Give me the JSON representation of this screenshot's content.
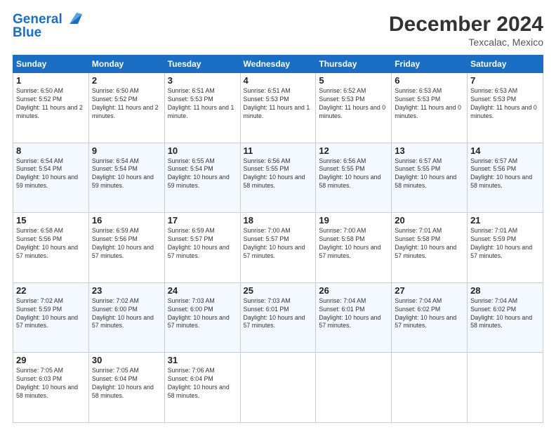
{
  "header": {
    "logo_line1": "General",
    "logo_line2": "Blue",
    "month": "December 2024",
    "location": "Texcalac, Mexico"
  },
  "weekdays": [
    "Sunday",
    "Monday",
    "Tuesday",
    "Wednesday",
    "Thursday",
    "Friday",
    "Saturday"
  ],
  "weeks": [
    [
      {
        "day": "1",
        "sunrise": "Sunrise: 6:50 AM",
        "sunset": "Sunset: 5:52 PM",
        "daylight": "Daylight: 11 hours and 2 minutes."
      },
      {
        "day": "2",
        "sunrise": "Sunrise: 6:50 AM",
        "sunset": "Sunset: 5:52 PM",
        "daylight": "Daylight: 11 hours and 2 minutes."
      },
      {
        "day": "3",
        "sunrise": "Sunrise: 6:51 AM",
        "sunset": "Sunset: 5:53 PM",
        "daylight": "Daylight: 11 hours and 1 minute."
      },
      {
        "day": "4",
        "sunrise": "Sunrise: 6:51 AM",
        "sunset": "Sunset: 5:53 PM",
        "daylight": "Daylight: 11 hours and 1 minute."
      },
      {
        "day": "5",
        "sunrise": "Sunrise: 6:52 AM",
        "sunset": "Sunset: 5:53 PM",
        "daylight": "Daylight: 11 hours and 0 minutes."
      },
      {
        "day": "6",
        "sunrise": "Sunrise: 6:53 AM",
        "sunset": "Sunset: 5:53 PM",
        "daylight": "Daylight: 11 hours and 0 minutes."
      },
      {
        "day": "7",
        "sunrise": "Sunrise: 6:53 AM",
        "sunset": "Sunset: 5:53 PM",
        "daylight": "Daylight: 11 hours and 0 minutes."
      }
    ],
    [
      {
        "day": "8",
        "sunrise": "Sunrise: 6:54 AM",
        "sunset": "Sunset: 5:54 PM",
        "daylight": "Daylight: 10 hours and 59 minutes."
      },
      {
        "day": "9",
        "sunrise": "Sunrise: 6:54 AM",
        "sunset": "Sunset: 5:54 PM",
        "daylight": "Daylight: 10 hours and 59 minutes."
      },
      {
        "day": "10",
        "sunrise": "Sunrise: 6:55 AM",
        "sunset": "Sunset: 5:54 PM",
        "daylight": "Daylight: 10 hours and 59 minutes."
      },
      {
        "day": "11",
        "sunrise": "Sunrise: 6:56 AM",
        "sunset": "Sunset: 5:55 PM",
        "daylight": "Daylight: 10 hours and 58 minutes."
      },
      {
        "day": "12",
        "sunrise": "Sunrise: 6:56 AM",
        "sunset": "Sunset: 5:55 PM",
        "daylight": "Daylight: 10 hours and 58 minutes."
      },
      {
        "day": "13",
        "sunrise": "Sunrise: 6:57 AM",
        "sunset": "Sunset: 5:55 PM",
        "daylight": "Daylight: 10 hours and 58 minutes."
      },
      {
        "day": "14",
        "sunrise": "Sunrise: 6:57 AM",
        "sunset": "Sunset: 5:56 PM",
        "daylight": "Daylight: 10 hours and 58 minutes."
      }
    ],
    [
      {
        "day": "15",
        "sunrise": "Sunrise: 6:58 AM",
        "sunset": "Sunset: 5:56 PM",
        "daylight": "Daylight: 10 hours and 57 minutes."
      },
      {
        "day": "16",
        "sunrise": "Sunrise: 6:59 AM",
        "sunset": "Sunset: 5:56 PM",
        "daylight": "Daylight: 10 hours and 57 minutes."
      },
      {
        "day": "17",
        "sunrise": "Sunrise: 6:59 AM",
        "sunset": "Sunset: 5:57 PM",
        "daylight": "Daylight: 10 hours and 57 minutes."
      },
      {
        "day": "18",
        "sunrise": "Sunrise: 7:00 AM",
        "sunset": "Sunset: 5:57 PM",
        "daylight": "Daylight: 10 hours and 57 minutes."
      },
      {
        "day": "19",
        "sunrise": "Sunrise: 7:00 AM",
        "sunset": "Sunset: 5:58 PM",
        "daylight": "Daylight: 10 hours and 57 minutes."
      },
      {
        "day": "20",
        "sunrise": "Sunrise: 7:01 AM",
        "sunset": "Sunset: 5:58 PM",
        "daylight": "Daylight: 10 hours and 57 minutes."
      },
      {
        "day": "21",
        "sunrise": "Sunrise: 7:01 AM",
        "sunset": "Sunset: 5:59 PM",
        "daylight": "Daylight: 10 hours and 57 minutes."
      }
    ],
    [
      {
        "day": "22",
        "sunrise": "Sunrise: 7:02 AM",
        "sunset": "Sunset: 5:59 PM",
        "daylight": "Daylight: 10 hours and 57 minutes."
      },
      {
        "day": "23",
        "sunrise": "Sunrise: 7:02 AM",
        "sunset": "Sunset: 6:00 PM",
        "daylight": "Daylight: 10 hours and 57 minutes."
      },
      {
        "day": "24",
        "sunrise": "Sunrise: 7:03 AM",
        "sunset": "Sunset: 6:00 PM",
        "daylight": "Daylight: 10 hours and 57 minutes."
      },
      {
        "day": "25",
        "sunrise": "Sunrise: 7:03 AM",
        "sunset": "Sunset: 6:01 PM",
        "daylight": "Daylight: 10 hours and 57 minutes."
      },
      {
        "day": "26",
        "sunrise": "Sunrise: 7:04 AM",
        "sunset": "Sunset: 6:01 PM",
        "daylight": "Daylight: 10 hours and 57 minutes."
      },
      {
        "day": "27",
        "sunrise": "Sunrise: 7:04 AM",
        "sunset": "Sunset: 6:02 PM",
        "daylight": "Daylight: 10 hours and 57 minutes."
      },
      {
        "day": "28",
        "sunrise": "Sunrise: 7:04 AM",
        "sunset": "Sunset: 6:02 PM",
        "daylight": "Daylight: 10 hours and 58 minutes."
      }
    ],
    [
      {
        "day": "29",
        "sunrise": "Sunrise: 7:05 AM",
        "sunset": "Sunset: 6:03 PM",
        "daylight": "Daylight: 10 hours and 58 minutes."
      },
      {
        "day": "30",
        "sunrise": "Sunrise: 7:05 AM",
        "sunset": "Sunset: 6:04 PM",
        "daylight": "Daylight: 10 hours and 58 minutes."
      },
      {
        "day": "31",
        "sunrise": "Sunrise: 7:06 AM",
        "sunset": "Sunset: 6:04 PM",
        "daylight": "Daylight: 10 hours and 58 minutes."
      },
      null,
      null,
      null,
      null
    ]
  ]
}
